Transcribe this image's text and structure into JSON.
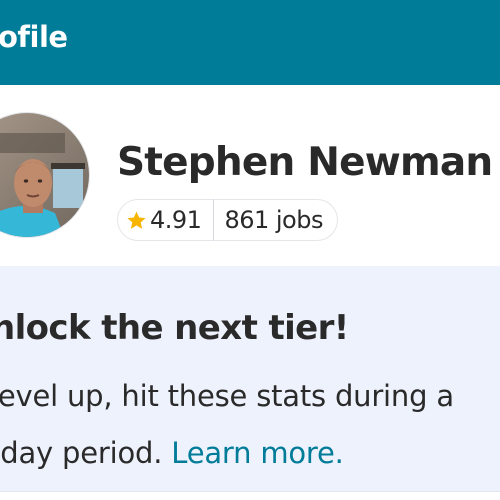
{
  "header": {
    "title": "ofile"
  },
  "profile": {
    "name": "Stephen Newman",
    "rating": "4.91",
    "jobs": "861 jobs",
    "star_icon": "star-icon",
    "avatar_icon": "avatar"
  },
  "tier": {
    "title": "nlock the next tier!",
    "line1": " level up, hit these stats during a",
    "line2_prefix": "-day period. ",
    "link": "Learn more."
  },
  "colors": {
    "header_bg": "#007c99",
    "accent": "#007c99",
    "star": "#f7b500",
    "card_bg": "#eef2fd",
    "text": "#2a2a2a"
  }
}
